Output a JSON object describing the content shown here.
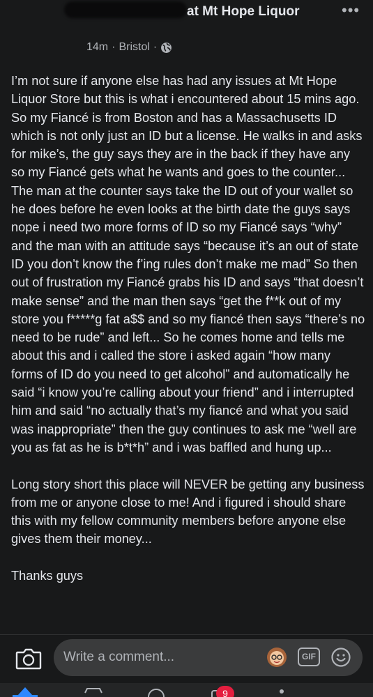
{
  "header": {
    "title": "at Mt Hope Liquor",
    "more_label": "•••",
    "time": "14m",
    "separator": "·",
    "location": "Bristol",
    "separator2": "·"
  },
  "post": {
    "paragraphs": [
      "I’m not sure if anyone else has had any issues at Mt Hope Liquor Store but this is what i encountered about 15 mins ago. So my Fiancé is from Boston and has a Massachusetts ID which is not only just an ID but a license. He walks in and asks for mike’s, the guy says they are in the back if they have any so my Fiancé gets what he wants and goes to the counter... The man at the counter says take the ID out of your wallet so he does before he even looks at the birth date the guys says nope i need two more forms of ID so my Fiancé says “why” and the man with an attitude says “because it’s an out of state ID you don’t know the f’ing rules don’t make me mad” So then out of frustration my Fiancé grabs his ID and says “that doesn’t make sense” and the man then says “get the f**k out of my store you f*****g fat a$$ and so my fiancé then says “there’s no need to be rude” and left... So he comes home and tells me about this and i called the store i asked again “how many forms of ID do you need to get alcohol” and automatically he said “i know you’re calling about your friend” and i interrupted him and said “no actually that’s my fiancé and what you said was inappropriate” then the guy continues to ask me “well are you as fat as he is b*t*h” and i was baffled and hung up...",
      "Long story short this place will NEVER be getting any business from me or anyone close to me! And i figured i should share this with my fellow community members before anyone else gives them their money...",
      "Thanks guys"
    ]
  },
  "comment_bar": {
    "placeholder": "Write a comment...",
    "gif_label": "GIF"
  },
  "nav": {
    "notification_count": "9"
  },
  "colors": {
    "background": "#18191a",
    "text": "#e4e6eb",
    "muted": "#b0b3b8",
    "input_bg": "#3a3b3c",
    "accent": "#2d88ff",
    "badge": "#e41e3f"
  }
}
